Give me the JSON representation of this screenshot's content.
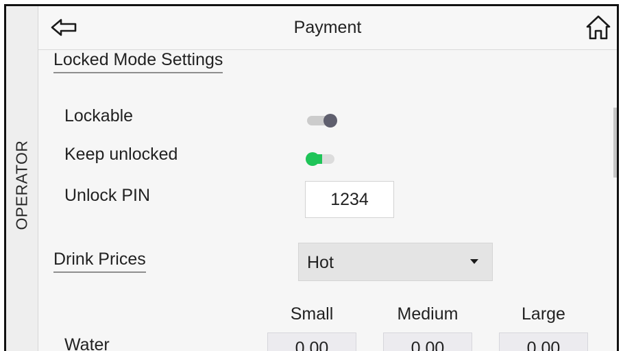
{
  "sidebar": {
    "label": "OPERATOR"
  },
  "header": {
    "title": "Payment",
    "back_icon": "back-arrow-icon",
    "home_icon": "home-icon"
  },
  "locked_mode": {
    "section_title": "Locked Mode Settings",
    "lockable": {
      "label": "Lockable",
      "state": "off"
    },
    "keep_unlocked": {
      "label": "Keep unlocked",
      "state": "on"
    },
    "unlock_pin": {
      "label": "Unlock PIN",
      "value": "1234"
    }
  },
  "drink_prices": {
    "section_title": "Drink Prices",
    "selected": "Hot",
    "columns": [
      "Small",
      "Medium",
      "Large"
    ],
    "rows": [
      {
        "name": "Water",
        "values": [
          "0.00",
          "0.00",
          "0.00"
        ]
      }
    ]
  },
  "colors": {
    "toggle_on": "#1fc458",
    "toggle_off_knob": "#5f5f6e",
    "background": "#f6f6f6",
    "sidebar": "#eeeeee"
  }
}
